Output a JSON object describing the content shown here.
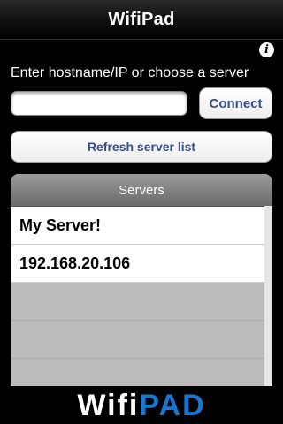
{
  "app": {
    "title": "WifiPad"
  },
  "info": {
    "icon": "info-icon",
    "glyph": "i"
  },
  "connect_form": {
    "prompt": "Enter hostname/IP or choose a server",
    "input_value": "",
    "input_placeholder": "",
    "connect_label": "Connect"
  },
  "refresh": {
    "label": "Refresh server list"
  },
  "servers": {
    "header": "Servers",
    "items": [
      {
        "label": "My Server!"
      },
      {
        "label": "192.168.20.106"
      }
    ]
  },
  "footer": {
    "logo_part1": "Wifi",
    "logo_part2": "PAD"
  },
  "colors": {
    "accent_button_text": "#374e86",
    "logo_blue": "#1877d2",
    "background": "#000000"
  }
}
